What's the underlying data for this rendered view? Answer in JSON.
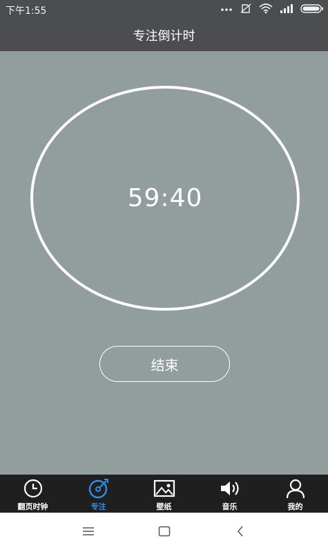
{
  "status_bar": {
    "time": "下午1:55",
    "icons": [
      "more-dots-icon",
      "no-sim-icon",
      "wifi-icon",
      "signal-icon",
      "battery-icon"
    ]
  },
  "header": {
    "title": "专注倒计时"
  },
  "timer": {
    "display": "59:40"
  },
  "actions": {
    "end_label": "结束"
  },
  "tabs": [
    {
      "label": "翻页时钟",
      "icon": "clock-icon",
      "active": false
    },
    {
      "label": "专注",
      "icon": "focus-target-icon",
      "active": true
    },
    {
      "label": "壁纸",
      "icon": "image-icon",
      "active": false
    },
    {
      "label": "音乐",
      "icon": "speaker-icon",
      "active": false
    },
    {
      "label": "我的",
      "icon": "user-icon",
      "active": false
    }
  ],
  "nav_bar": {
    "buttons": [
      "menu-icon",
      "home-icon",
      "back-icon"
    ]
  },
  "colors": {
    "header_bg": "#4b4d4f",
    "main_bg": "#929e9e",
    "tab_bg": "#1f1f20",
    "accent": "#2f8fe0"
  }
}
